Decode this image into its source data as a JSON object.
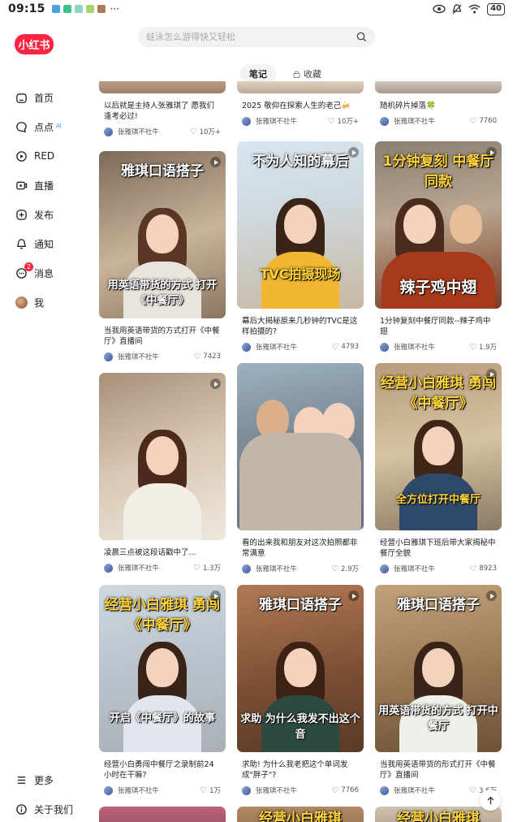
{
  "status": {
    "time": "09:15",
    "dots": "···",
    "battery": "40"
  },
  "logo": "小红书",
  "sidebar": {
    "items": [
      {
        "label": "首页"
      },
      {
        "label": "点点",
        "tag": "AI"
      },
      {
        "label": "RED"
      },
      {
        "label": "直播"
      },
      {
        "label": "发布"
      },
      {
        "label": "通知"
      },
      {
        "label": "消息",
        "badge": "2"
      },
      {
        "label": "我"
      }
    ],
    "more": "更多",
    "about": "关于我们"
  },
  "search": {
    "placeholder": "蛙泳怎么游得快又轻松"
  },
  "tabs": [
    {
      "label": "笔记"
    },
    {
      "label": "收藏"
    }
  ],
  "feed": {
    "row0": [
      {
        "title": "以后就是主持人张雅琪了 愿我们逢考必过!",
        "author": "张雅琪不社牛",
        "likes": "10万+"
      },
      {
        "title": "2025 敬仰在探索人生的老己🍻",
        "author": "张雅琪不社牛",
        "likes": "10万+"
      },
      {
        "title": "随机碎片掉落🍀",
        "author": "张雅琪不社牛",
        "likes": "7760"
      }
    ],
    "row1": [
      {
        "overlay_top": "雅琪口语搭子",
        "overlay_bottom": "用英语带货的方式 打开《中餐厅》",
        "title": "当我用英语带货的方式打开《中餐厅》直播间",
        "author": "张雅琪不社牛",
        "likes": "7423"
      },
      {
        "overlay_top": "不为人知的幕后",
        "overlay_bottom": "TVC拍摄现场",
        "title": "幕后大揭秘原来几秒钟的TVC是这样拍摄的?",
        "author": "张雅琪不社牛",
        "likes": "4793"
      },
      {
        "overlay_top": "1分钟复刻 中餐厅同款",
        "overlay_bottom": "辣子鸡中翅",
        "title": "1分钟复刻中餐厅同款--辣子鸡中翅",
        "author": "张雅琪不社牛",
        "likes": "1.9万"
      }
    ],
    "row2": [
      {
        "overlay_top": "",
        "overlay_bottom": "",
        "title": "凌晨三点被这段话戳中了...",
        "author": "张雅琪不社牛",
        "likes": "1.3万"
      },
      {
        "overlay_top": "",
        "overlay_bottom": "",
        "title": "看的出来我和朋友对这次拍照都非常满意",
        "author": "张雅琪不社牛",
        "likes": "2.9万"
      },
      {
        "overlay_top": "经营小白雅琪 勇闯《中餐厅》",
        "overlay_bottom": "全方位打开中餐厅",
        "title": "经营小白雅琪下班后带大家揭秘中餐厅全貌",
        "author": "张雅琪不社牛",
        "likes": "8923"
      }
    ],
    "row3": [
      {
        "overlay_top": "经营小白雅琪 勇闯《中餐厅》",
        "overlay_bottom": "开启《中餐厅》的故事",
        "title": "经营小白勇闯中餐厅之录制前24小时在干嘛?",
        "author": "张雅琪不社牛",
        "likes": "1万"
      },
      {
        "overlay_top": "雅琪口语搭子",
        "overlay_bottom": "求助 为什么我发不出这个音",
        "title": "求助! 为什么我老把这个单词发成\"胖子\"?",
        "author": "张雅琪不社牛",
        "likes": "7766"
      },
      {
        "overlay_top": "雅琪口语搭子",
        "overlay_bottom": "用英语带货的方式 打开中餐厅",
        "title": "当我用英语带货的形式打开《中餐厅》直播间",
        "author": "张雅琪不社牛",
        "likes": "3.6万"
      }
    ],
    "row4": [
      {
        "overlay_top": ""
      },
      {
        "overlay_top": "经营小白雅琪"
      },
      {
        "overlay_top": "经营小白雅琪"
      }
    ]
  },
  "colors": {
    "brand": "#ff2442",
    "background": "#ffffff",
    "search_bg": "#f2f2f3"
  }
}
